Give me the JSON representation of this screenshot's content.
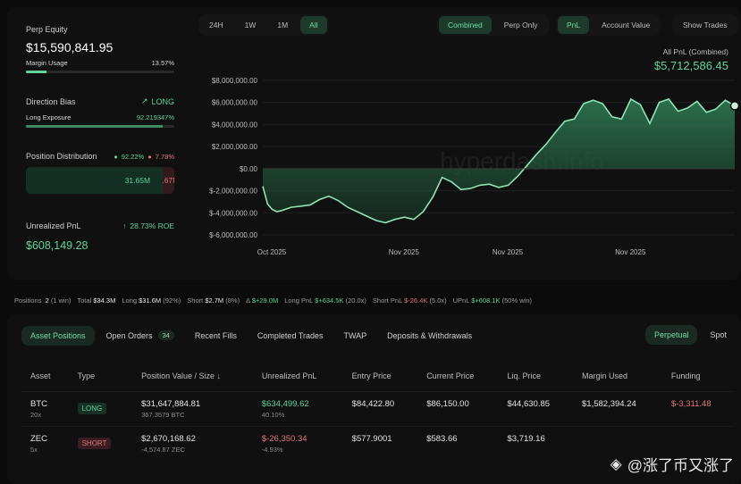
{
  "left": {
    "perp_equity_label": "Perp Equity",
    "perp_equity_value": "$15,590,841.95",
    "margin_usage_label": "Margin Usage",
    "margin_usage_value": "13.57%",
    "margin_usage_fraction": 0.1357,
    "direction_bias_label": "Direction Bias",
    "direction_bias_value": "LONG",
    "long_exposure_label": "Long Exposure",
    "long_exposure_value": "92.219347%",
    "long_exposure_fraction": 0.922,
    "position_distribution_label": "Position Distribution",
    "dist_long_pct": "92.22%",
    "dist_short_pct": "7.78%",
    "dist_long_value": "31.65M",
    "dist_short_value": "2.67M",
    "unrealized_pnl_label": "Unrealized PnL",
    "roe_value": "28.73% ROE",
    "unrealized_pnl_value": "$608,149.28"
  },
  "time_ranges": [
    "24H",
    "1W",
    "1M",
    "All"
  ],
  "active_time_range": "All",
  "view_modes": [
    "Combined",
    "Perp Only"
  ],
  "active_view_mode": "Combined",
  "metric_modes": [
    "PnL",
    "Account Value"
  ],
  "active_metric_mode": "PnL",
  "show_trades_label": "Show Trades",
  "pnl_summary": {
    "label": "All PnL (Combined)",
    "value": "$5,712,586.45"
  },
  "watermark_text": "hyperdash.info",
  "chart_data": {
    "type": "area",
    "title": "",
    "xlabel": "",
    "ylabel": "",
    "y_ticks": [
      "$8,000,000.00",
      "$6,000,000.00",
      "$4,000,000.00",
      "$2,000,000.00",
      "$0.00",
      "$-2,000,000.00",
      "$-4,000,000.00",
      "$-6,000,000.00"
    ],
    "y_tick_values": [
      8000000,
      6000000,
      4000000,
      2000000,
      0,
      -2000000,
      -4000000,
      -6000000
    ],
    "x_tick_labels": [
      "Oct 2025",
      "Nov 2025",
      "Nov 2025",
      "Nov 2025"
    ],
    "x_tick_positions": [
      0,
      0.28,
      0.5,
      0.76
    ],
    "ylim": [
      -6000000,
      8000000
    ],
    "grid": true,
    "color": "#5fd39a",
    "x": [
      0,
      0.01,
      0.02,
      0.03,
      0.04,
      0.06,
      0.08,
      0.1,
      0.12,
      0.14,
      0.16,
      0.18,
      0.2,
      0.22,
      0.24,
      0.26,
      0.28,
      0.3,
      0.32,
      0.34,
      0.36,
      0.38,
      0.4,
      0.42,
      0.44,
      0.46,
      0.48,
      0.5,
      0.52,
      0.54,
      0.56,
      0.58,
      0.6,
      0.62,
      0.64,
      0.66,
      0.68,
      0.7,
      0.72,
      0.74,
      0.76,
      0.78,
      0.8,
      0.82,
      0.84,
      0.86,
      0.88,
      0.9,
      0.92,
      0.94,
      0.96,
      0.98,
      1.0
    ],
    "values": [
      -1600000,
      -3200000,
      -3700000,
      -3900000,
      -3800000,
      -3500000,
      -3400000,
      -3300000,
      -2800000,
      -2500000,
      -2900000,
      -3500000,
      -3900000,
      -4300000,
      -4700000,
      -4900000,
      -4600000,
      -4400000,
      -4600000,
      -3900000,
      -2600000,
      -800000,
      -1200000,
      -1900000,
      -1800000,
      -1500000,
      -1400000,
      -1700000,
      -1500000,
      -700000,
      300000,
      1300000,
      2200000,
      3300000,
      4300000,
      4500000,
      5900000,
      6200000,
      5900000,
      4700000,
      4500000,
      6300000,
      5800000,
      4100000,
      6000000,
      6300000,
      5200000,
      5500000,
      6100000,
      5100000,
      5400000,
      6200000,
      5700000
    ]
  },
  "stats": {
    "positions_label": "Positions",
    "positions_value": "2",
    "positions_note": "(1 win)",
    "total_label": "Total",
    "total_value": "$34.3M",
    "long_label": "Long",
    "long_value": "$31.6M",
    "long_note": "(92%)",
    "short_label": "Short",
    "short_value": "$2.7M",
    "short_note": "(8%)",
    "delta_label": "Δ",
    "delta_value": "$+29.0M",
    "long_pnl_label": "Long PnL",
    "long_pnl_value": "$+634.5K",
    "long_pnl_note": "(20.0x)",
    "short_pnl_label": "Short PnL",
    "short_pnl_value": "$-26.4K",
    "short_pnl_note": "(5.0x)",
    "upnl_label": "UPnL",
    "upnl_value": "$+608.1K",
    "upnl_note": "(50% win)"
  },
  "tabs": {
    "asset_positions": "Asset Positions",
    "open_orders": "Open Orders",
    "open_orders_count": "34",
    "recent_fills": "Recent Fills",
    "completed_trades": "Completed Trades",
    "twap": "TWAP",
    "deposits": "Deposits & Withdrawals"
  },
  "market_modes": {
    "perpetual": "Perpetual",
    "spot": "Spot"
  },
  "table": {
    "headers": {
      "asset": "Asset",
      "type": "Type",
      "position": "Position Value / Size",
      "sort_icon": "↓",
      "upnl": "Unrealized PnL",
      "entry": "Entry Price",
      "current": "Current Price",
      "liq": "Liq. Price",
      "margin": "Margin Used",
      "funding": "Funding"
    },
    "rows": [
      {
        "asset": "BTC",
        "leverage": "20x",
        "type": "LONG",
        "position_value": "$31,647,884.81",
        "size": "367.3579 BTC",
        "upnl": "$634,499.62",
        "upnl_pct": "40.10%",
        "entry": "$84,422.80",
        "current": "$86,150.00",
        "liq": "$44,630.85",
        "margin": "$1,582,394.24",
        "funding": "$-3,311.48"
      },
      {
        "asset": "ZEC",
        "leverage": "5x",
        "type": "SHORT",
        "position_value": "$2,670,168.62",
        "size": "-4,574.87 ZEC",
        "upnl": "$-26,350.34",
        "upnl_pct": "-4.93%",
        "entry": "$577.9001",
        "current": "$583.66",
        "liq": "$3,719.16",
        "margin": "",
        "funding": ""
      }
    ]
  },
  "social_watermark": "@涨了币又涨了"
}
